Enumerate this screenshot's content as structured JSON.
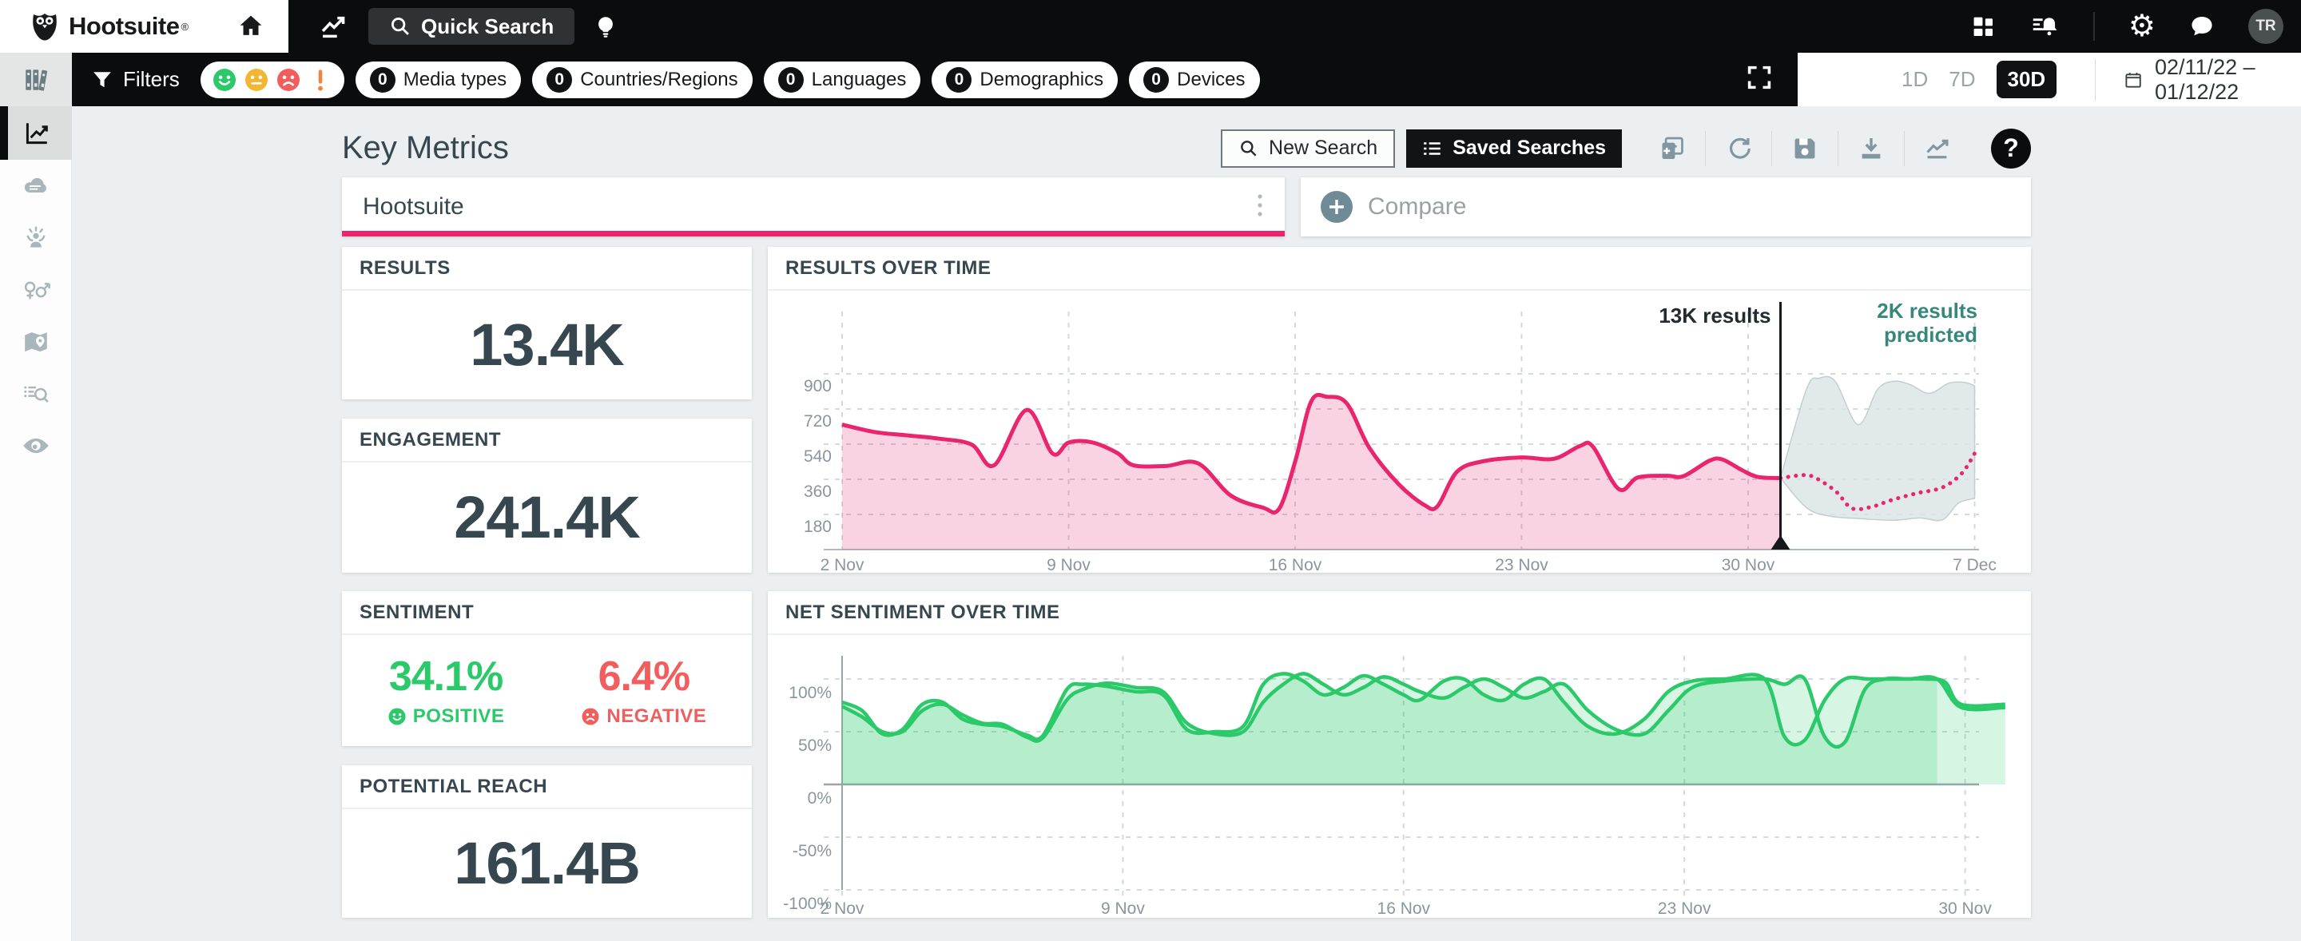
{
  "colors": {
    "accent_pink": "#e8256d",
    "positive_green": "#2bc96a",
    "negative_red": "#f25e5e",
    "neutral_yellow": "#f2b632",
    "alert_orange": "#f5823c",
    "predicted_teal": "#37877c",
    "dark_slate": "#36474f",
    "band_gray": "#dbe3e6"
  },
  "topbar": {
    "brand": "Hootsuite",
    "brand_mark": "®",
    "quick_search": "Quick Search",
    "avatar": "TR"
  },
  "filters": {
    "label": "Filters",
    "sentiment_icons": [
      "positive",
      "neutral",
      "negative",
      "alert"
    ],
    "pills": [
      {
        "count": "0",
        "label": "Media types"
      },
      {
        "count": "0",
        "label": "Countries/Regions"
      },
      {
        "count": "0",
        "label": "Languages"
      },
      {
        "count": "0",
        "label": "Demographics"
      },
      {
        "count": "0",
        "label": "Devices"
      }
    ]
  },
  "view_controls": {
    "ranges": [
      "1D",
      "7D",
      "30D"
    ],
    "active_range": "30D",
    "date_range": "02/11/22 – 01/12/22"
  },
  "header": {
    "title": "Key Metrics",
    "new_search": "New Search",
    "saved_searches": "Saved Searches"
  },
  "tabs": {
    "search_name": "Hootsuite",
    "compare": "Compare"
  },
  "metrics": {
    "results": {
      "label": "RESULTS",
      "value": "13.4K"
    },
    "engagement": {
      "label": "ENGAGEMENT",
      "value": "241.4K"
    },
    "sentiment": {
      "label": "SENTIMENT",
      "positive_value": "34.1%",
      "positive_label": "POSITIVE",
      "negative_value": "6.4%",
      "negative_label": "NEGATIVE"
    },
    "potential_reach": {
      "label": "POTENTIAL REACH",
      "value": "161.4B"
    }
  },
  "chart_data": [
    {
      "type": "area",
      "title": "RESULTS OVER TIME",
      "x_unit": "days since 2 Nov",
      "ylim": [
        0,
        990
      ],
      "grid": true,
      "y_ticks": [
        {
          "v": 180,
          "label": "180"
        },
        {
          "v": 360,
          "label": "360"
        },
        {
          "v": 540,
          "label": "540"
        },
        {
          "v": 720,
          "label": "720"
        },
        {
          "v": 900,
          "label": "900"
        }
      ],
      "x_ticks": [
        {
          "d": 0,
          "label": "2 Nov"
        },
        {
          "d": 7,
          "label": "9 Nov"
        },
        {
          "d": 14,
          "label": "16 Nov"
        },
        {
          "d": 21,
          "label": "23 Nov"
        },
        {
          "d": 28,
          "label": "30 Nov"
        },
        {
          "d": 35,
          "label": "7 Dec"
        }
      ],
      "series": [
        {
          "name": "results",
          "style": "area-line",
          "points": [
            [
              0,
              640
            ],
            [
              1,
              602
            ],
            [
              2,
              585
            ],
            [
              3,
              568
            ],
            [
              4,
              538
            ],
            [
              4.7,
              432
            ],
            [
              5.7,
              715
            ],
            [
              6.5,
              492
            ],
            [
              7,
              548
            ],
            [
              7.7,
              550
            ],
            [
              8.5,
              495
            ],
            [
              9,
              432
            ],
            [
              10,
              428
            ],
            [
              11,
              442
            ],
            [
              12,
              278
            ],
            [
              13,
              215
            ],
            [
              13.5,
              208
            ],
            [
              14,
              450
            ],
            [
              14.5,
              760
            ],
            [
              15,
              782
            ],
            [
              15.6,
              748
            ],
            [
              16.3,
              520
            ],
            [
              17.2,
              335
            ],
            [
              18,
              228
            ],
            [
              18.4,
              222
            ],
            [
              19,
              398
            ],
            [
              19.8,
              452
            ],
            [
              21,
              472
            ],
            [
              22,
              465
            ],
            [
              22.8,
              530
            ],
            [
              23.2,
              528
            ],
            [
              24,
              310
            ],
            [
              24.6,
              370
            ],
            [
              25.5,
              378
            ],
            [
              26,
              376
            ],
            [
              26.8,
              455
            ],
            [
              27.2,
              462
            ],
            [
              27.8,
              408
            ],
            [
              28.3,
              372
            ],
            [
              29,
              366
            ]
          ]
        },
        {
          "name": "results_predicted",
          "style": "dotted",
          "points": [
            [
              29,
              366
            ],
            [
              29.6,
              380
            ],
            [
              30,
              374
            ],
            [
              30.7,
              300
            ],
            [
              31.2,
              212
            ],
            [
              31.8,
              218
            ],
            [
              32.4,
              252
            ],
            [
              33.2,
              288
            ],
            [
              34,
              318
            ],
            [
              34.6,
              390
            ],
            [
              35,
              492
            ]
          ]
        },
        {
          "name": "prediction_band_upper",
          "style": "band",
          "points": [
            [
              29,
              366
            ],
            [
              29.8,
              820
            ],
            [
              30.2,
              878
            ],
            [
              30.7,
              860
            ],
            [
              31.4,
              640
            ],
            [
              32,
              820
            ],
            [
              32.5,
              862
            ],
            [
              33,
              845
            ],
            [
              33.6,
              800
            ],
            [
              34.2,
              852
            ],
            [
              34.7,
              856
            ],
            [
              35,
              838
            ]
          ]
        },
        {
          "name": "prediction_band_lower",
          "style": "band",
          "points": [
            [
              29,
              366
            ],
            [
              29.8,
              215
            ],
            [
              30.5,
              172
            ],
            [
              31.5,
              158
            ],
            [
              32.5,
              150
            ],
            [
              33.3,
              162
            ],
            [
              34,
              152
            ],
            [
              34.5,
              238
            ],
            [
              35,
              262
            ]
          ]
        }
      ],
      "annotations": {
        "marker_day": 29,
        "marker_label": "13K results",
        "predicted_label_line1": "2K results",
        "predicted_label_line2": "predicted"
      }
    },
    {
      "type": "area",
      "title": "NET SENTIMENT OVER TIME",
      "x_unit": "days since 2 Nov",
      "ylim": [
        -100,
        112
      ],
      "grid": true,
      "y_ticks": [
        {
          "v": 100,
          "label": "100%"
        },
        {
          "v": 50,
          "label": "50%"
        },
        {
          "v": 0,
          "label": "0%"
        },
        {
          "v": -50,
          "label": "-50%"
        },
        {
          "v": -100,
          "label": "-100%"
        }
      ],
      "x_ticks": [
        {
          "d": 0,
          "label": "2 Nov"
        },
        {
          "d": 7,
          "label": "9 Nov"
        },
        {
          "d": 14,
          "label": "16 Nov"
        },
        {
          "d": 21,
          "label": "23 Nov"
        },
        {
          "d": 28,
          "label": "30 Nov"
        }
      ],
      "series": [
        {
          "name": "net_sentiment",
          "style": "area-line",
          "points": [
            [
              0,
              78
            ],
            [
              0.5,
              70
            ],
            [
              1,
              48
            ],
            [
              1.5,
              52
            ],
            [
              2,
              76
            ],
            [
              2.5,
              78
            ],
            [
              3,
              62
            ],
            [
              3.5,
              57
            ],
            [
              4,
              55
            ],
            [
              4.6,
              47
            ],
            [
              5,
              46
            ],
            [
              5.6,
              90
            ],
            [
              6,
              95
            ],
            [
              6.6,
              93
            ],
            [
              7.3,
              88
            ],
            [
              8,
              85
            ],
            [
              8.6,
              52
            ],
            [
              9.3,
              50
            ],
            [
              10,
              55
            ],
            [
              10.5,
              95
            ],
            [
              11,
              105
            ],
            [
              11.5,
              98
            ],
            [
              12,
              85
            ],
            [
              12.5,
              92
            ],
            [
              13,
              103
            ],
            [
              13.5,
              95
            ],
            [
              14,
              85
            ],
            [
              14.4,
              80
            ],
            [
              15,
              98
            ],
            [
              15.5,
              100
            ],
            [
              16,
              85
            ],
            [
              16.5,
              80
            ],
            [
              17,
              95
            ],
            [
              17.5,
              100
            ],
            [
              18,
              78
            ],
            [
              18.6,
              55
            ],
            [
              19.3,
              48
            ],
            [
              20,
              62
            ],
            [
              20.6,
              88
            ],
            [
              21.2,
              98
            ],
            [
              22,
              100
            ],
            [
              23,
              100
            ],
            [
              23.5,
              45
            ],
            [
              24,
              42
            ],
            [
              24.5,
              80
            ],
            [
              25,
              100
            ],
            [
              25.6,
              100
            ],
            [
              26.3,
              100
            ],
            [
              27,
              100
            ],
            [
              27.5,
              97
            ],
            [
              27.9,
              76
            ],
            [
              29,
              76
            ]
          ]
        },
        {
          "name": "net_sentiment_secondary",
          "style": "area-line",
          "area_end_day": 27.3,
          "points": [
            [
              0,
              74
            ],
            [
              0.5,
              64
            ],
            [
              1,
              50
            ],
            [
              1.5,
              50
            ],
            [
              2,
              70
            ],
            [
              2.5,
              76
            ],
            [
              3,
              66
            ],
            [
              3.5,
              58
            ],
            [
              4,
              57
            ],
            [
              4.6,
              45
            ],
            [
              5,
              44
            ],
            [
              5.6,
              80
            ],
            [
              6,
              90
            ],
            [
              6.6,
              96
            ],
            [
              7.3,
              92
            ],
            [
              8,
              88
            ],
            [
              8.6,
              58
            ],
            [
              9.3,
              48
            ],
            [
              10,
              50
            ],
            [
              10.5,
              78
            ],
            [
              11,
              95
            ],
            [
              11.5,
              105
            ],
            [
              12,
              95
            ],
            [
              12.5,
              85
            ],
            [
              13,
              92
            ],
            [
              13.5,
              102
            ],
            [
              14,
              95
            ],
            [
              14.4,
              88
            ],
            [
              15,
              82
            ],
            [
              15.5,
              92
            ],
            [
              16,
              100
            ],
            [
              16.5,
              92
            ],
            [
              17,
              82
            ],
            [
              17.5,
              88
            ],
            [
              18,
              95
            ],
            [
              18.6,
              70
            ],
            [
              19.3,
              52
            ],
            [
              20,
              48
            ],
            [
              20.6,
              70
            ],
            [
              21.2,
              92
            ],
            [
              22,
              98
            ],
            [
              23,
              100
            ],
            [
              23.5,
              95
            ],
            [
              24,
              100
            ],
            [
              24.5,
              45
            ],
            [
              25,
              40
            ],
            [
              25.5,
              90
            ],
            [
              26,
              100
            ],
            [
              26.6,
              100
            ],
            [
              27.3,
              100
            ],
            [
              27.9,
              73
            ],
            [
              29,
              73
            ]
          ]
        }
      ]
    }
  ]
}
